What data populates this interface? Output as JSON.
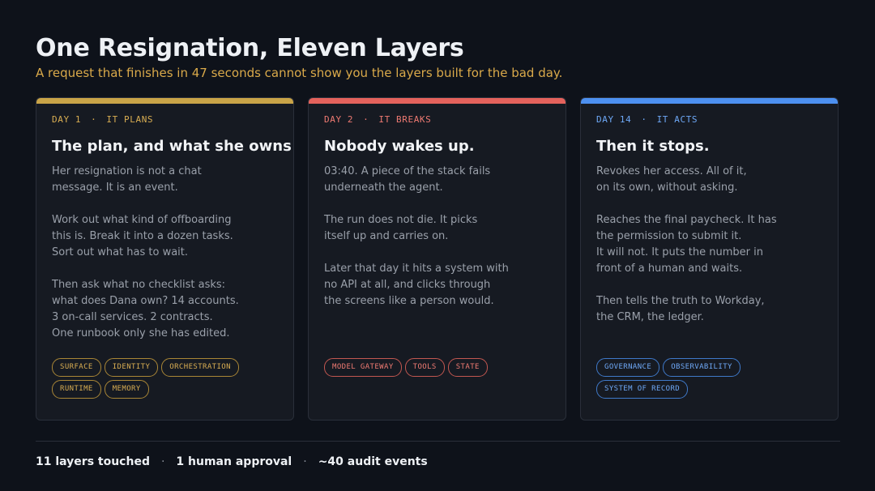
{
  "title": "One Resignation, Eleven Layers",
  "subtitle": "A request that finishes in 47 seconds cannot show you the layers built for the bad day.",
  "colors": {
    "day1": "#c9a448",
    "day2": "#e4625c",
    "day3": "#4d90f0",
    "background": "#0e121a"
  },
  "cards": [
    {
      "day": "DAY 1",
      "phase": "IT PLANS",
      "heading": "The plan, and what she owns",
      "paragraphs": [
        "Her resignation is not a chat\nmessage. It is an event.",
        "Work out what kind of offboarding\nthis is. Break it into a dozen tasks.\nSort out what has to wait.",
        "Then ask what no checklist asks:\nwhat does Dana own? 14 accounts.\n3 on-call services. 2 contracts.\nOne runbook only she has edited."
      ],
      "tags": [
        "SURFACE",
        "IDENTITY",
        "ORCHESTRATION",
        "RUNTIME",
        "MEMORY"
      ]
    },
    {
      "day": "DAY 2",
      "phase": "IT BREAKS",
      "heading": "Nobody wakes up.",
      "paragraphs": [
        "03:40. A piece of the stack fails\nunderneath the agent.",
        "The run does not die. It picks\nitself up and carries on.",
        "Later that day it hits a system with\nno API at all, and clicks through\nthe screens like a person would."
      ],
      "tags": [
        "MODEL GATEWAY",
        "TOOLS",
        "STATE"
      ]
    },
    {
      "day": "DAY 14",
      "phase": "IT ACTS",
      "heading": "Then it stops.",
      "paragraphs": [
        "Revokes her access. All of it,\non its own, without asking.",
        "Reaches the final paycheck. It has\nthe permission to submit it.\nIt will not. It puts the number in\nfront of a human and waits.",
        "Then tells the truth to Workday,\nthe CRM, the ledger."
      ],
      "tags": [
        "GOVERNANCE",
        "OBSERVABILITY",
        "SYSTEM OF RECORD"
      ]
    }
  ],
  "footer": {
    "stats": [
      "11 layers touched",
      "1 human approval",
      "~40 audit events"
    ],
    "separator": "·"
  }
}
